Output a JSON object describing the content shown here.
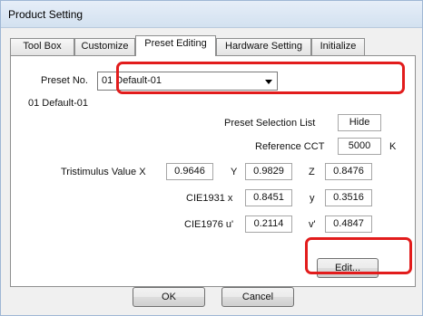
{
  "window": {
    "title": "Product Setting"
  },
  "tabs": [
    {
      "label": "Tool Box"
    },
    {
      "label": "Customize"
    },
    {
      "label": "Preset Editing"
    },
    {
      "label": "Hardware Setting"
    },
    {
      "label": "Initialize"
    }
  ],
  "active_tab": "Preset Editing",
  "preset": {
    "label": "Preset No.",
    "selected": "01 Default-01",
    "heading": "01 Default-01"
  },
  "selection_list": {
    "label": "Preset Selection List",
    "value": "Hide"
  },
  "reference_cct": {
    "label": "Reference CCT",
    "value": "5000",
    "unit": "K"
  },
  "tristimulus": {
    "label": "Tristimulus Value X",
    "x": "0.9646",
    "y_label": "Y",
    "y": "0.9829",
    "z_label": "Z",
    "z": "0.8476"
  },
  "cie1931": {
    "label": "CIE1931 x",
    "x": "0.8451",
    "y_label": "y",
    "y": "0.3516"
  },
  "cie1976": {
    "label": "CIE1976 u'",
    "u": "0.2114",
    "v_label": "v'",
    "v": "0.4847"
  },
  "buttons": {
    "edit": "Edit...",
    "ok": "OK",
    "cancel": "Cancel"
  },
  "colors": {
    "highlight": "#e21c1c",
    "titlebar": "#d3e1f0"
  }
}
